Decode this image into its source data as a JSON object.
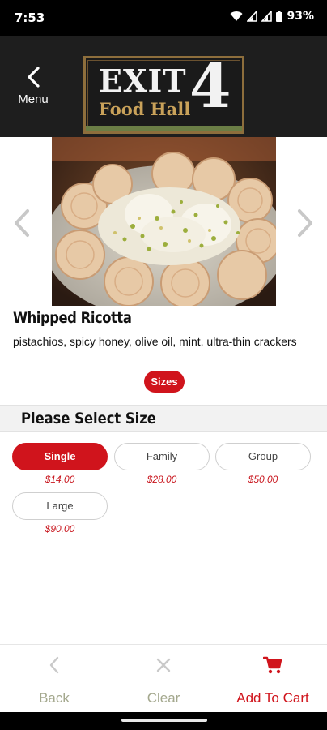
{
  "status_bar": {
    "time": "7:53",
    "battery": "93%",
    "icons": [
      "wifi-icon",
      "signal-icon",
      "signal-icon",
      "battery-icon"
    ]
  },
  "header": {
    "menu_label": "Menu",
    "menu_icon": "chevron-left-icon",
    "logo": {
      "word": "EXIT",
      "number": "4",
      "subtitle": "Food Hall"
    }
  },
  "product": {
    "title": "Whipped Ricotta",
    "description": "pistachios, spicy honey, olive oil, mint, ultra-thin crackers",
    "sizes_pill": "Sizes",
    "image_alt": "Whipped ricotta with pistachios on crackers"
  },
  "size_section": {
    "title": "Please Select Size",
    "options": [
      {
        "label": "Single",
        "price": "$14.00",
        "selected": true
      },
      {
        "label": "Family",
        "price": "$28.00",
        "selected": false
      },
      {
        "label": "Group",
        "price": "$50.00",
        "selected": false
      },
      {
        "label": "Large",
        "price": "$90.00",
        "selected": false
      }
    ]
  },
  "bottom_nav": {
    "back": "Back",
    "clear": "Clear",
    "add_to_cart": "Add To Cart"
  },
  "colors": {
    "accent": "#d0141c",
    "header_bg": "#1e1e1e",
    "logo_gold": "#c9a25a",
    "nav_muted": "#a4a88e"
  }
}
